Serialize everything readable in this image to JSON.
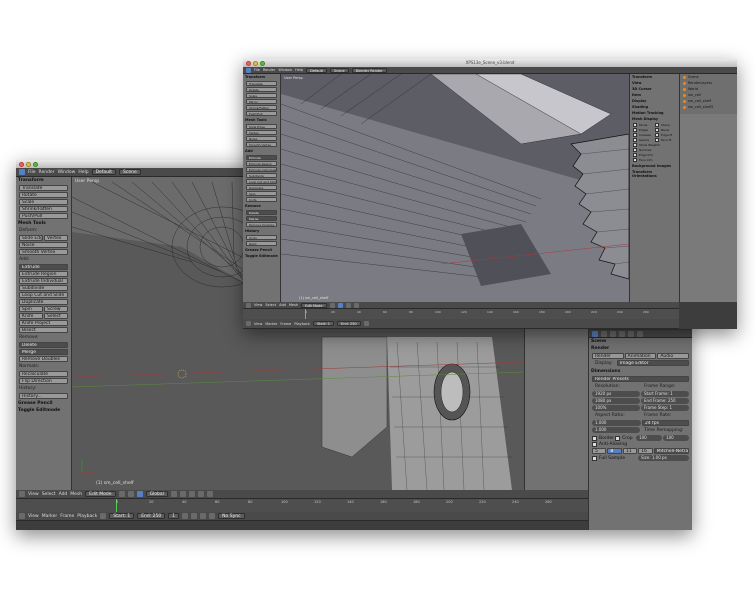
{
  "back_window": {
    "menu": [
      "File",
      "Render",
      "Window",
      "Help"
    ],
    "layout": "Default",
    "scene": "Scene",
    "tool_shelf": {
      "transform_header": "Transform",
      "transform_buttons": [
        "Translate",
        "Rotate",
        "Scale",
        "Shrink/Fatten",
        "Push/Pull"
      ],
      "mesh_tools_header": "Mesh Tools",
      "deform_label": "Deform:",
      "deform_buttons": [
        [
          "Slide Edge",
          "Vertex"
        ],
        [
          "Noise"
        ],
        [
          "Smooth Vertex"
        ]
      ],
      "add_label": "Add:",
      "add_select": "Extrude",
      "add_buttons": [
        "Extrude Region",
        "Extrude Individual",
        "Subdivide",
        "Loop Cut and Slide",
        "Duplicate"
      ],
      "add_pairs": [
        [
          "Spin",
          "Screw"
        ],
        [
          "Knife",
          "Select"
        ]
      ],
      "add_buttons_2": [
        "Knife Project",
        "Bisect"
      ],
      "remove_label": "Remove:",
      "remove_buttons": [
        "Delete",
        "Merge",
        "Remove Doubles"
      ],
      "normals_label": "Normals:",
      "normals_buttons": [
        "Recalculate",
        "Flip Direction"
      ],
      "uv_label": "UV Mapping:",
      "shading_label": "Shading:",
      "history_label": "History:",
      "history_buttons": [
        "Undo",
        "Redo",
        "Repeat Last",
        "History..."
      ],
      "grease_pencil": "Grease Pencil",
      "toggle_edit_mode": "Toggle Editmode"
    },
    "viewport": {
      "label": "User Persp",
      "object_name": "(1) sm_cell_shelf"
    },
    "view_header": {
      "items": [
        "View",
        "Select",
        "Add",
        "Mesh"
      ],
      "mode": "Edit Mode",
      "pivot": "Global"
    },
    "properties_n": {
      "cursor_header": "3D Cursor",
      "cursor": [
        {
          "axis": "X:",
          "value": "0.0000"
        },
        {
          "axis": "Y:",
          "value": "0.0000"
        },
        {
          "axis": "Z:",
          "value": "0.0000"
        }
      ],
      "item_header": "Item",
      "item_name": "sm_cell_shelf",
      "display_header": "Display",
      "shading_header": "Shading",
      "motion_tracking": "Motion Tracking",
      "mesh_display_header": "Mesh Display",
      "overlays_label": "Overlays:",
      "overlays": [
        [
          "Faces",
          "Sharp"
        ],
        [
          "Edges",
          "Bevel"
        ],
        [
          "Creases",
          "Edge M"
        ],
        [
          "Seams",
          "Face M"
        ]
      ],
      "show_weights": "Show Weights"
    },
    "render_props": {
      "header": "Scene",
      "render_header": "Render",
      "render_buttons": [
        "Render",
        "Animation",
        "Audio"
      ],
      "display_label": "Display:",
      "display_value": "Image Editor",
      "dimensions_header": "Dimensions",
      "presets": "Render Presets",
      "resolution_label": "Resolution:",
      "frame_range_label": "Frame Range:",
      "res_x": "1920 px",
      "res_y": "1080 px",
      "res_pct": "100%",
      "start_frame": "Start Frame: 1",
      "end_frame": "End Frame: 250",
      "frame_step": "Frame Step: 1",
      "aspect_label": "Aspect Ratio:",
      "frame_rate_label": "Frame Rate:",
      "aspect_x": "1.000",
      "aspect_y": "1.000",
      "fps": "24 fps",
      "time_remapping": "Time Remapping:",
      "remap_old": "100",
      "remap_new": "100",
      "border": "Border",
      "crop": "Crop",
      "anti_aliasing": "Anti-Aliasing",
      "aa_samples": [
        "5",
        "8",
        "11",
        "16"
      ],
      "filter": "Mitchell-Netravali",
      "full_sample": "Full Sample",
      "size": "Size: 1.00 px"
    },
    "timeline": {
      "ticks": [
        "0",
        "20",
        "40",
        "60",
        "80",
        "100",
        "120",
        "140",
        "160",
        "180",
        "200",
        "220",
        "240",
        "260"
      ],
      "menu": [
        "View",
        "Marker",
        "Frame",
        "Playback"
      ],
      "start": "Start: 1",
      "end": "End: 250",
      "current": "1",
      "sync": "No Sync"
    }
  },
  "front_window": {
    "title": "XPS13e_Scene_v3.blend",
    "menu": [
      "File",
      "Render",
      "Window",
      "Help"
    ],
    "layout": "Default",
    "scene": "Scene",
    "render_engine": "Blender Render",
    "tool_shelf": {
      "header": "Transform",
      "buttons": [
        "Translate",
        "Rotate",
        "Scale",
        "Mirror",
        "Shrink/Fatten",
        "Push/Pull"
      ],
      "section2": "Mesh Tools",
      "buttons2": [
        "Slide Edge",
        "Vertex",
        "Noise",
        "Smooth Vertex"
      ],
      "section3": "Add",
      "buttons3": [
        "Extrude",
        "Extrude Region",
        "Extrude Individual",
        "Subdivide",
        "Loop Cut and Slide",
        "Duplicate",
        "Spin",
        "Knife"
      ],
      "section4": "Remove",
      "buttons4": [
        "Delete",
        "Merge",
        "Remove Doubles"
      ],
      "section5": "History",
      "buttons5": [
        "Undo",
        "Redo"
      ],
      "grease_pencil": "Grease Pencil",
      "toggle": "Toggle Editmode"
    },
    "viewport": {
      "label": "User Persp",
      "object_name": "(1) sm_cell_shelf"
    },
    "view_header": {
      "items": [
        "View",
        "Select",
        "Add",
        "Mesh"
      ],
      "mode": "Edit Mode"
    },
    "timeline": {
      "ticks": [
        "0",
        "20",
        "40",
        "60",
        "80",
        "100",
        "120",
        "140",
        "160",
        "180",
        "200",
        "220",
        "240",
        "260"
      ],
      "menu": [
        "View",
        "Marker",
        "Frame",
        "Playback"
      ],
      "start": "Start: 1",
      "end": "End: 250"
    },
    "outliner": {
      "items": [
        "Scene",
        "RenderLayers",
        "World",
        "sm_cell",
        "sm_cell_shelf",
        "sm_cell_shelf2"
      ]
    },
    "n_panel": {
      "items": [
        "Transform",
        "View",
        "3D Cursor",
        "Item",
        "Display",
        "Shading",
        "Motion Tracking",
        "Mesh Display"
      ],
      "overlays": [
        [
          "Faces",
          "Sharp"
        ],
        [
          "Edges",
          "Bevel"
        ],
        [
          "Creases",
          "Edge M"
        ],
        [
          "Seams",
          "Face M"
        ]
      ],
      "extra": [
        "Show Weights",
        "Normals",
        "Edge Info",
        "Face Info"
      ],
      "bg_images": "Background Images",
      "transform_orient": "Transform Orientations"
    },
    "colors": {
      "accent": "#5680c2",
      "bg": "#3d3d3d",
      "panel": "#727272"
    }
  }
}
